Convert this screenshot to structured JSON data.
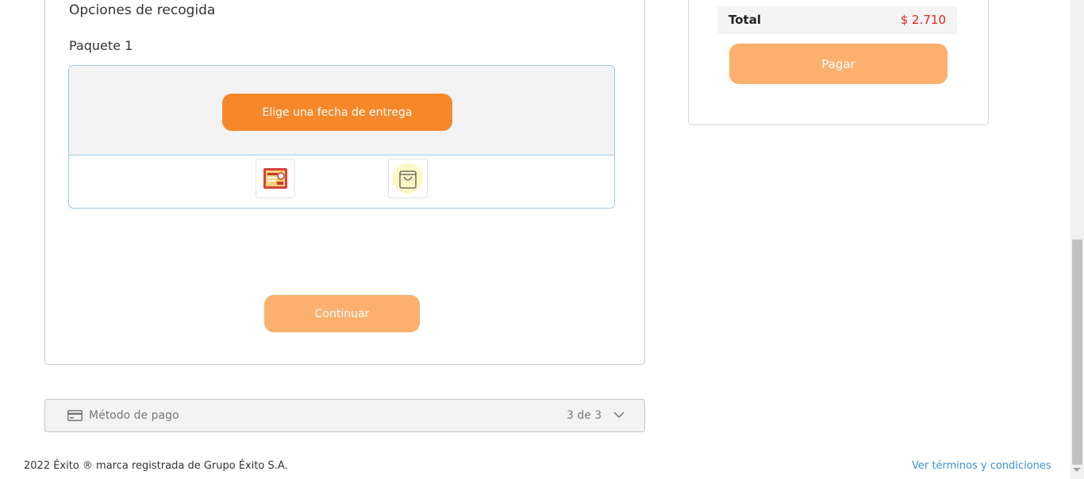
{
  "pickup": {
    "section_title": "Opciones de recogida",
    "package_title": "Paquete 1",
    "date_button_label": "Elige una fecha de entrega",
    "thumbnails": [
      {
        "icon": "product-package-icon"
      },
      {
        "icon": "shopping-bag-icon"
      }
    ],
    "continue_label": "Continuar"
  },
  "payment_method": {
    "icon": "credit-card-icon",
    "label": "Método de pago",
    "step": "3 de 3"
  },
  "summary": {
    "total_label": "Total",
    "total_value": "$ 2.710",
    "pay_label": "Pagar"
  },
  "footer": {
    "copyright": "2022 Éxito ® marca registrada de Grupo Éxito S.A.",
    "terms_link": "Ver términos y condiciones"
  },
  "colors": {
    "accent": "#f7882a",
    "accent_disabled": "#fbb06e",
    "price": "#e2231a",
    "link": "#3a92d1",
    "border_blue": "#9ccbe8"
  }
}
